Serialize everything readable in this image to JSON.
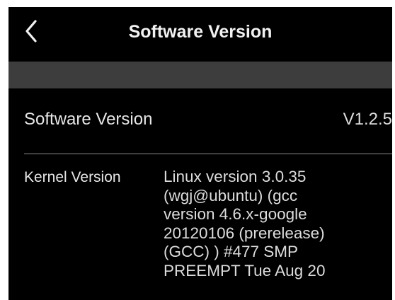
{
  "header": {
    "title": "Software Version",
    "back_icon": "chevron-left-icon"
  },
  "software_row": {
    "label": "Software Version",
    "value": "V1.2.5"
  },
  "kernel_row": {
    "label": "Kernel Version",
    "value_lines": [
      "Linux version 3.0.35",
      "(wgj@ubuntu) (gcc",
      "version 4.6.x-google",
      "20120106 (prerelease)",
      "(GCC) ) #477 SMP",
      "PREEMPT Tue Aug 20"
    ]
  },
  "colors": {
    "background": "#000000",
    "band": "#3d3d3d",
    "text": "#e6e6e6",
    "divider": "#8a8a8a"
  }
}
